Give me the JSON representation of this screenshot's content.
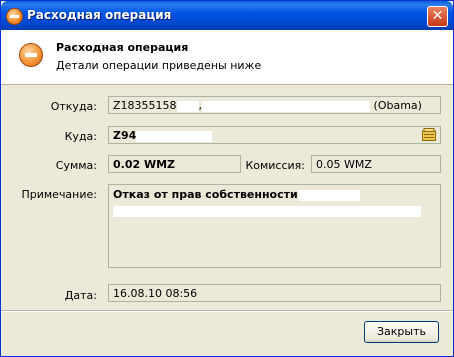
{
  "window": {
    "title": "Расходная операция",
    "close": "✕"
  },
  "header": {
    "title": "Расходная операция",
    "subtitle": "Детали операции приведены ниже"
  },
  "fields": {
    "from_label": "Откуда:",
    "from_value": "Z18355158",
    "from_suffix": "(Obama)",
    "to_label": "Куда:",
    "to_value": "Z94",
    "sum_label": "Сумма:",
    "sum_value": "0.02 WMZ",
    "fee_label": "Комиссия:",
    "fee_value": "0.05 WMZ",
    "note_label": "Примечание:",
    "note_value": "Отказ от прав собственности",
    "date_label": "Дата:",
    "date_value": "16.08.10 08:56"
  },
  "buttons": {
    "close": "Закрыть"
  },
  "colors": {
    "titlebar": "#0055e5",
    "dialog_bg": "#ece9d8",
    "icon": "#f28a28"
  }
}
